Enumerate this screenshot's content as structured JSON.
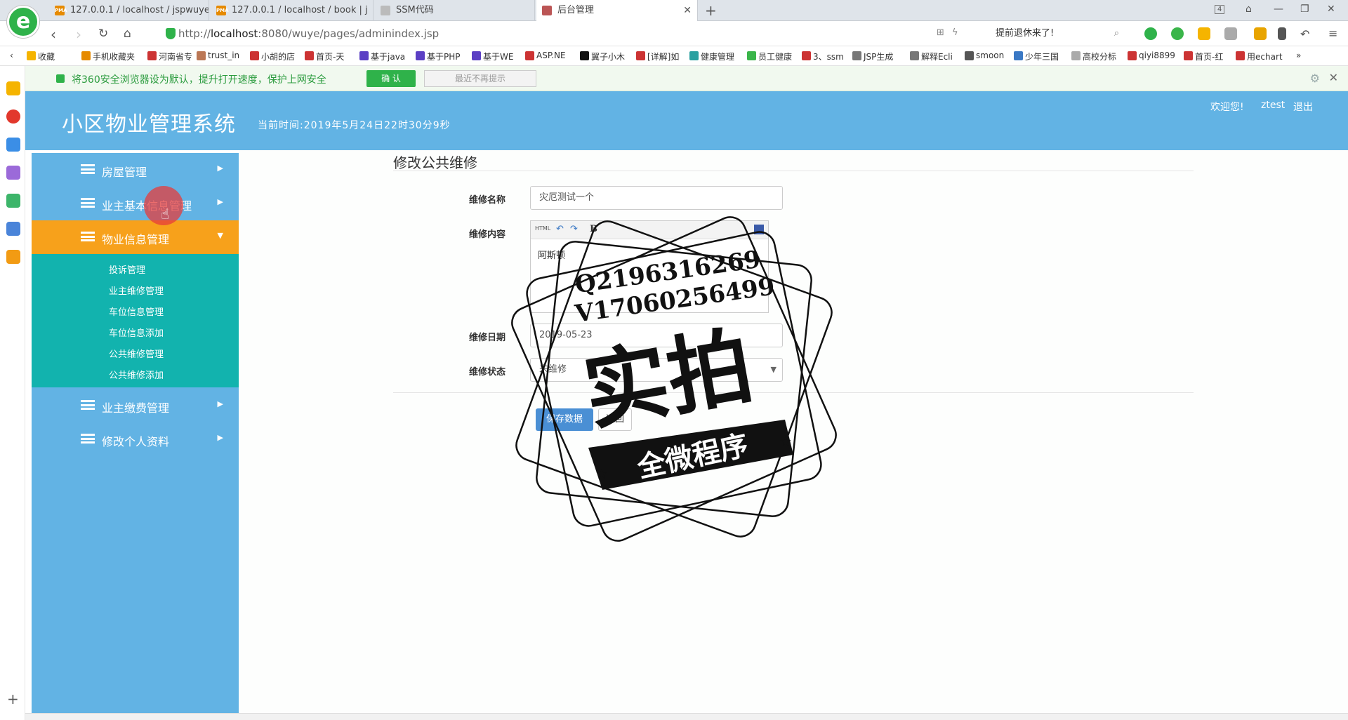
{
  "browser": {
    "tabs": [
      {
        "title": "127.0.0.1 / localhost / jspwuye",
        "fav": "PMA",
        "fav_color": "#e68a00"
      },
      {
        "title": "127.0.0.1 / localhost / book | j",
        "fav": "PMA",
        "fav_color": "#e68a00"
      },
      {
        "title": "SSM代码",
        "fav": "",
        "fav_color": "#aaaaaa"
      },
      {
        "title": "后台管理",
        "fav": "",
        "fav_color": "#b55",
        "active": true
      }
    ],
    "tab_count": "4",
    "url_prefix": "http://",
    "url_host": "localhost",
    "url_rest": ":8080/wuye/pages/adminindex.jsp",
    "search_text": "提前退休来了!",
    "bookmarks": [
      "收藏",
      "手机收藏夹",
      "河南省专",
      "trust_in",
      "小胡的店",
      "首页-天",
      "基于java",
      "基于PHP",
      "基于WE",
      "ASP.NE",
      "翼子小木",
      "[详解]如",
      "健康管理",
      "员工健康",
      "3、ssm",
      "JSP生成",
      "解释Ecli",
      "smoon",
      "少年三国",
      "高校分标",
      "qiyi8899",
      "首页-红",
      "用echart"
    ],
    "notice": {
      "text": "将360安全浏览器设为默认，提升打开速度，保护上网安全",
      "confirm": "确 认",
      "dismiss": "最近不再提示"
    }
  },
  "app": {
    "title": "小区物业管理系统",
    "time": "当前时间:2019年5月24日22时30分9秒",
    "welcome": "欢迎您!",
    "user": "ztest",
    "logout": "退出",
    "menu": [
      {
        "label": "房屋管理"
      },
      {
        "label": "业主基本信息管理"
      },
      {
        "label": "物业信息管理",
        "active": true
      },
      {
        "label": "业主缴费管理"
      },
      {
        "label": "修改个人资料"
      }
    ],
    "submenu": [
      "投诉管理",
      "业主维修管理",
      "车位信息管理",
      "车位信息添加",
      "公共维修管理",
      "公共维修添加"
    ],
    "form": {
      "title": "修改公共维修",
      "name_label": "维修名称",
      "name_value": "灾厄测试一个",
      "content_label": "维修内容",
      "content_value": "阿斯顿",
      "editor_tb_html": "HTML",
      "editor_tb_bold": "B",
      "date_label": "维修日期",
      "date_value": "2019-05-23",
      "status_label": "维修状态",
      "status_value": "未维修",
      "save": "保存数据",
      "back": "返回"
    }
  },
  "watermark": {
    "line1": "Q2196316269",
    "line2": "V1706025649​9",
    "big": "实拍",
    "banner": "全微程序"
  }
}
